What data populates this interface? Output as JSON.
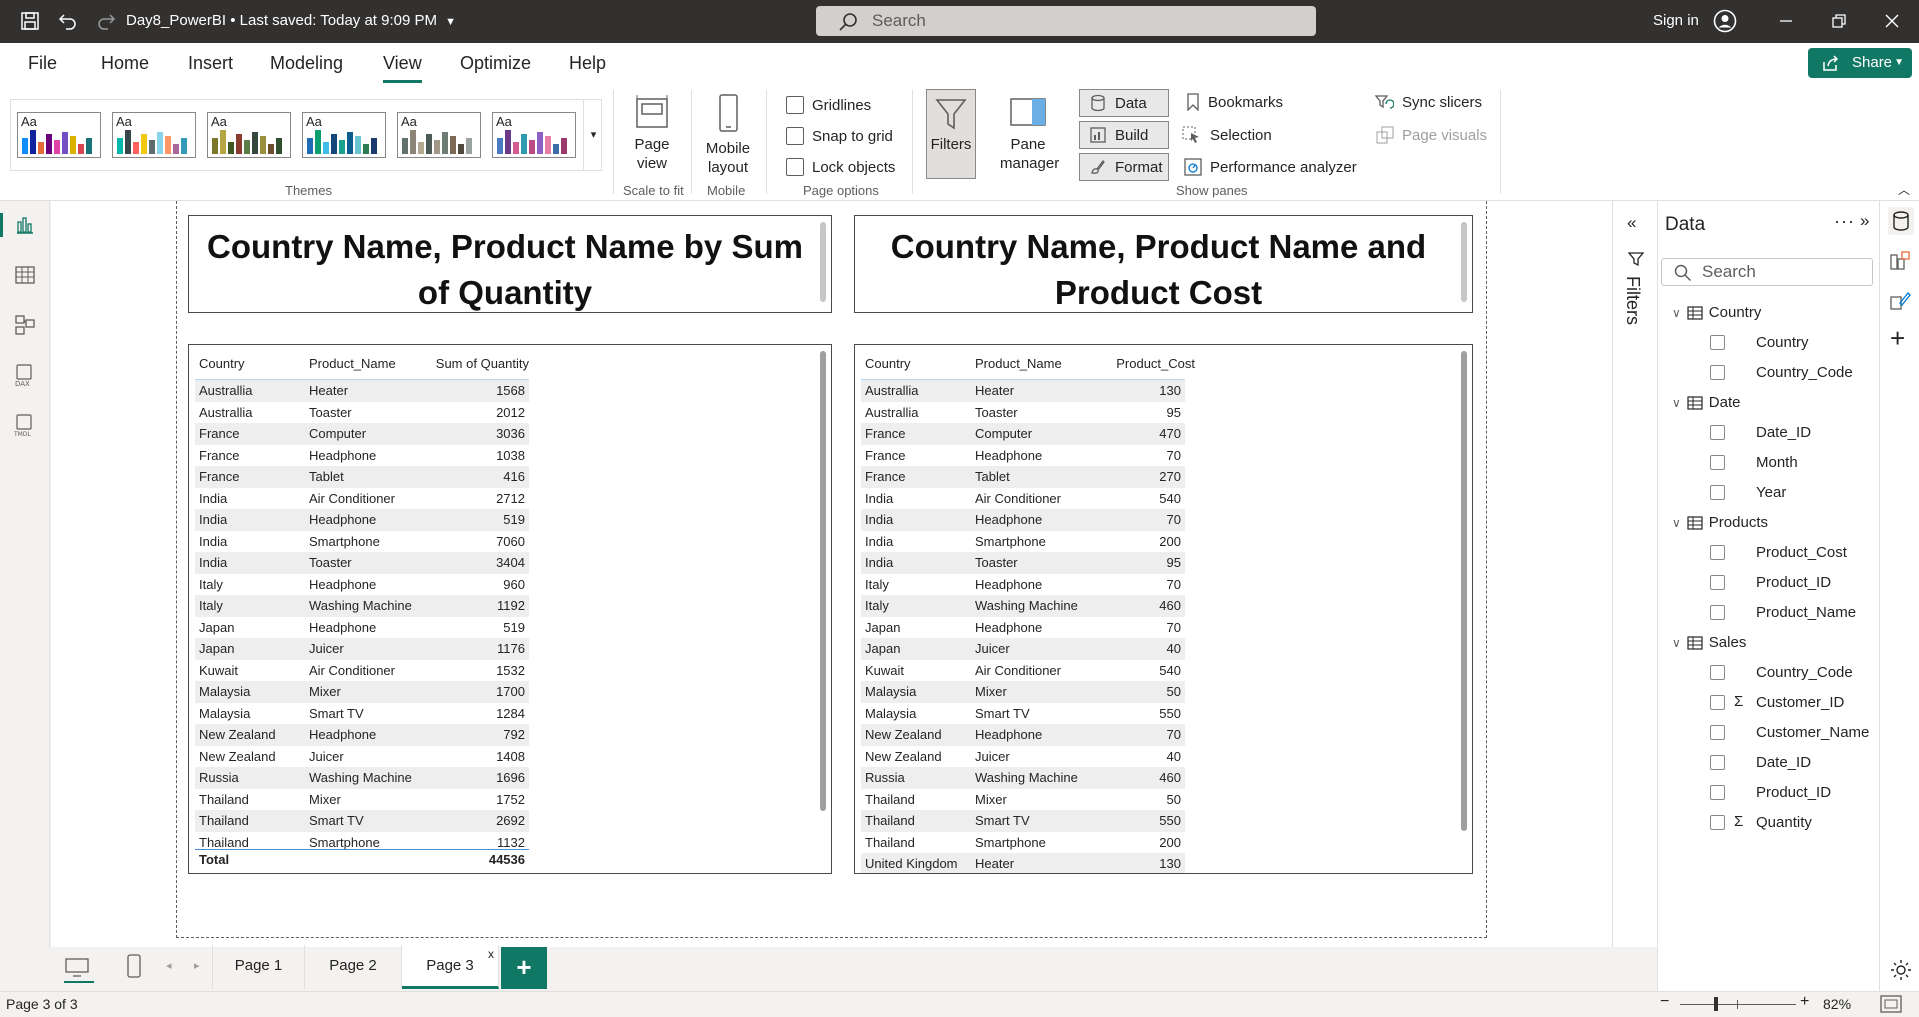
{
  "titlebar": {
    "doc_title": "Day8_PowerBI",
    "saved": "• Last saved: Today at 9:09 PM",
    "search_placeholder": "Search",
    "signin": "Sign in"
  },
  "ribbon_tabs": [
    "File",
    "Home",
    "Insert",
    "Modeling",
    "View",
    "Optimize",
    "Help"
  ],
  "active_tab": "View",
  "share_label": "Share",
  "ribbon": {
    "themes_label": "Themes",
    "theme_aa": "Aa",
    "page_view": "Page view",
    "scale_to_fit": "Scale to fit",
    "mobile_layout": "Mobile layout",
    "mobile_label": "Mobile",
    "gridlines": "Gridlines",
    "snap_to_grid": "Snap to grid",
    "lock_objects": "Lock objects",
    "page_options_label": "Page options",
    "filters": "Filters",
    "pane_manager": "Pane manager",
    "data": "Data",
    "build": "Build",
    "format": "Format",
    "bookmarks": "Bookmarks",
    "selection": "Selection",
    "performance_analyzer": "Performance analyzer",
    "sync_slicers": "Sync slicers",
    "page_visuals": "Page visuals",
    "show_panes_label": "Show panes"
  },
  "visual1": {
    "title": "Country Name, Product Name by Sum of Quantity",
    "headers": [
      "Country",
      "Product_Name",
      "Sum of Quantity"
    ],
    "rows": [
      [
        "Australlia",
        "Heater",
        "1568"
      ],
      [
        "Australlia",
        "Toaster",
        "2012"
      ],
      [
        "France",
        "Computer",
        "3036"
      ],
      [
        "France",
        "Headphone",
        "1038"
      ],
      [
        "France",
        "Tablet",
        "416"
      ],
      [
        "India",
        "Air Conditioner",
        "2712"
      ],
      [
        "India",
        "Headphone",
        "519"
      ],
      [
        "India",
        "Smartphone",
        "7060"
      ],
      [
        "India",
        "Toaster",
        "3404"
      ],
      [
        "Italy",
        "Headphone",
        "960"
      ],
      [
        "Italy",
        "Washing Machine",
        "1192"
      ],
      [
        "Japan",
        "Headphone",
        "519"
      ],
      [
        "Japan",
        "Juicer",
        "1176"
      ],
      [
        "Kuwait",
        "Air Conditioner",
        "1532"
      ],
      [
        "Malaysia",
        "Mixer",
        "1700"
      ],
      [
        "Malaysia",
        "Smart TV",
        "1284"
      ],
      [
        "New Zealand",
        "Headphone",
        "792"
      ],
      [
        "New Zealand",
        "Juicer",
        "1408"
      ],
      [
        "Russia",
        "Washing Machine",
        "1696"
      ],
      [
        "Thailand",
        "Mixer",
        "1752"
      ],
      [
        "Thailand",
        "Smart TV",
        "2692"
      ],
      [
        "Thailand",
        "Smartphone",
        "1132"
      ]
    ],
    "total_label": "Total",
    "total_value": "44536"
  },
  "visual2": {
    "title": "Country Name, Product Name and Product Cost",
    "headers": [
      "Country",
      "Product_Name",
      "Product_Cost"
    ],
    "rows": [
      [
        "Australlia",
        "Heater",
        "130"
      ],
      [
        "Australlia",
        "Toaster",
        "95"
      ],
      [
        "France",
        "Computer",
        "470"
      ],
      [
        "France",
        "Headphone",
        "70"
      ],
      [
        "France",
        "Tablet",
        "270"
      ],
      [
        "India",
        "Air Conditioner",
        "540"
      ],
      [
        "India",
        "Headphone",
        "70"
      ],
      [
        "India",
        "Smartphone",
        "200"
      ],
      [
        "India",
        "Toaster",
        "95"
      ],
      [
        "Italy",
        "Headphone",
        "70"
      ],
      [
        "Italy",
        "Washing Machine",
        "460"
      ],
      [
        "Japan",
        "Headphone",
        "70"
      ],
      [
        "Japan",
        "Juicer",
        "40"
      ],
      [
        "Kuwait",
        "Air Conditioner",
        "540"
      ],
      [
        "Malaysia",
        "Mixer",
        "50"
      ],
      [
        "Malaysia",
        "Smart TV",
        "550"
      ],
      [
        "New Zealand",
        "Headphone",
        "70"
      ],
      [
        "New Zealand",
        "Juicer",
        "40"
      ],
      [
        "Russia",
        "Washing Machine",
        "460"
      ],
      [
        "Thailand",
        "Mixer",
        "50"
      ],
      [
        "Thailand",
        "Smart TV",
        "550"
      ],
      [
        "Thailand",
        "Smartphone",
        "200"
      ],
      [
        "United Kingdom",
        "Heater",
        "130"
      ]
    ]
  },
  "filters_label": "Filters",
  "data_pane": {
    "title": "Data",
    "search_placeholder": "Search",
    "tables": [
      {
        "name": "Country",
        "fields": [
          {
            "name": "Country",
            "sigma": false
          },
          {
            "name": "Country_Code",
            "sigma": false
          }
        ]
      },
      {
        "name": "Date",
        "fields": [
          {
            "name": "Date_ID",
            "sigma": false
          },
          {
            "name": "Month",
            "sigma": false
          },
          {
            "name": "Year",
            "sigma": false
          }
        ]
      },
      {
        "name": "Products",
        "fields": [
          {
            "name": "Product_Cost",
            "sigma": false
          },
          {
            "name": "Product_ID",
            "sigma": false
          },
          {
            "name": "Product_Name",
            "sigma": false
          }
        ]
      },
      {
        "name": "Sales",
        "fields": [
          {
            "name": "Country_Code",
            "sigma": false
          },
          {
            "name": "Customer_ID",
            "sigma": true
          },
          {
            "name": "Customer_Name",
            "sigma": false
          },
          {
            "name": "Date_ID",
            "sigma": false
          },
          {
            "name": "Product_ID",
            "sigma": false
          },
          {
            "name": "Quantity",
            "sigma": true
          }
        ]
      }
    ]
  },
  "pages": [
    "Page 1",
    "Page 2",
    "Page 3"
  ],
  "active_page": "Page 3",
  "status": {
    "page_info": "Page 3 of 3",
    "zoom": "82%"
  },
  "colors": {
    "accent": "#117865",
    "titlebar": "#323130",
    "canvas": "#ffffff"
  }
}
